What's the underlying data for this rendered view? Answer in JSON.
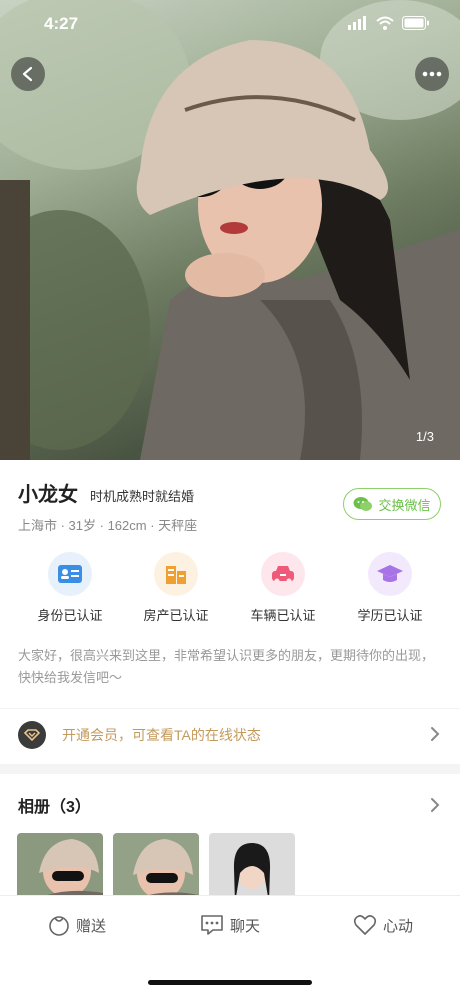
{
  "status_bar": {
    "time": "4:27"
  },
  "photo": {
    "pager": "1/3"
  },
  "profile": {
    "name": "小龙女",
    "motto": "时机成熟时就结婚",
    "meta": "上海市 · 31岁 · 162cm · 天秤座",
    "wechat_button": "交换微信",
    "intro": "大家好，很高兴来到这里，非常希望认识更多的朋友，更期待你的出现，快快给我发信吧～"
  },
  "verifications": [
    {
      "label": "身份已认证",
      "color": "#3a8ee6"
    },
    {
      "label": "房产已认证",
      "color": "#f0a033"
    },
    {
      "label": "车辆已认证",
      "color": "#f05a7a"
    },
    {
      "label": "学历已认证",
      "color": "#a873e6"
    }
  ],
  "member": {
    "text": "开通会员，可查看TA的在线状态"
  },
  "album": {
    "title": "相册（3）"
  },
  "bottom_tabs": {
    "gift": "赠送",
    "chat": "聊天",
    "like": "心动"
  }
}
